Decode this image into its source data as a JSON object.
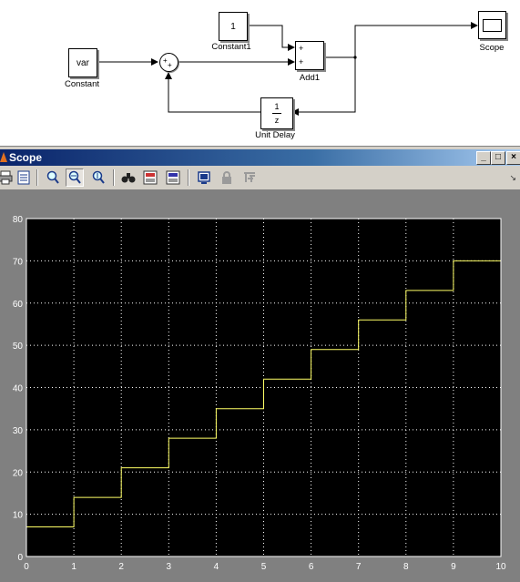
{
  "model": {
    "blocks": {
      "constant_value": "var",
      "constant_label": "Constant",
      "constant1_value": "1",
      "constant1_label": "Constant1",
      "add1_label": "Add1",
      "add1_signs": [
        "+",
        "+"
      ],
      "sum_signs": [
        "+",
        "+"
      ],
      "unit_delay_num": "1",
      "unit_delay_den": "z",
      "unit_delay_label": "Unit Delay",
      "scope_label": "Scope"
    }
  },
  "scope_window": {
    "title": "Scope",
    "controls": {
      "minimize": "_",
      "maximize": "□",
      "close": "×"
    },
    "toolbar_icons": [
      "print-icon",
      "parameters-icon",
      "zoom-in-icon",
      "zoom-x-icon",
      "zoom-y-icon",
      "autoscale-icon",
      "save-axes-icon",
      "restore-axes-icon",
      "floating-scope-icon",
      "lock-icon",
      "signal-selection-icon"
    ]
  },
  "chart_data": {
    "type": "line",
    "step": true,
    "x": [
      0,
      1,
      2,
      3,
      4,
      5,
      6,
      7,
      8,
      9,
      10
    ],
    "y": [
      7,
      14,
      21,
      28,
      35,
      42,
      49,
      56,
      63,
      70,
      77
    ],
    "xlim": [
      0,
      10
    ],
    "ylim": [
      0,
      80
    ],
    "xticks": [
      0,
      1,
      2,
      3,
      4,
      5,
      6,
      7,
      8,
      9,
      10
    ],
    "yticks": [
      0,
      10,
      20,
      30,
      40,
      50,
      60,
      70,
      80
    ],
    "grid": true,
    "background": "#000000",
    "line_color": "#ffff66",
    "grid_color": "#ffffff"
  }
}
